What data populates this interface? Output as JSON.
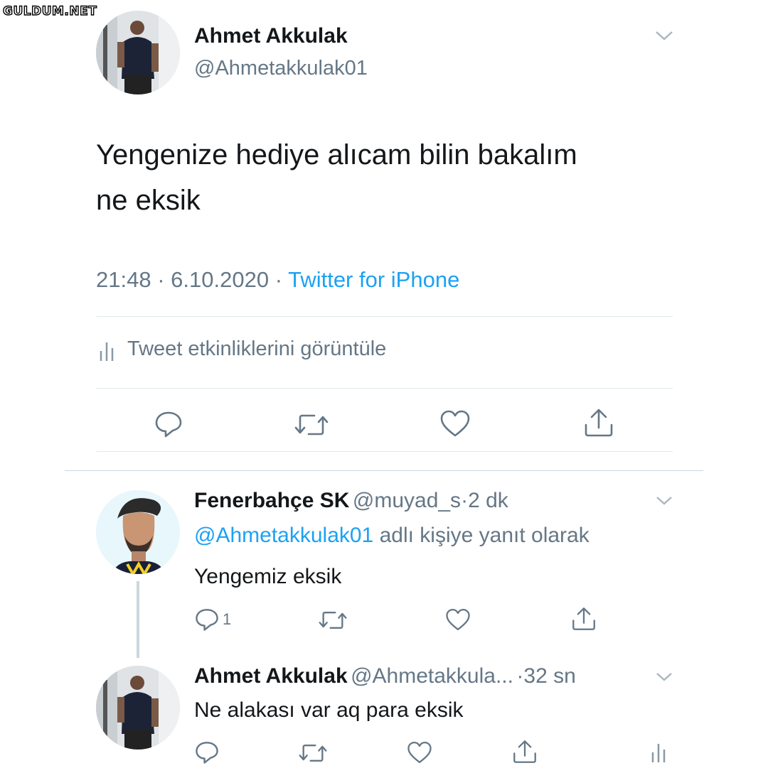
{
  "watermark": "GULDUM.NET",
  "main_tweet": {
    "author_name": "Ahmet Akkulak",
    "author_handle": "@Ahmetakkulak01",
    "text_line1": "Yengenize hediye alıcam bilin bakalım",
    "text_line2": "ne eksik",
    "time": "21:48",
    "date": "6.10.2020",
    "source": "Twitter for iPhone",
    "sep": "·",
    "activity_label": "Tweet etkinliklerini görüntüle"
  },
  "reply1": {
    "author_name": "Fenerbahçe SK",
    "author_handle": "@muyad_s",
    "time": "2 dk",
    "sep": "·",
    "reply_to_mention": "@Ahmetakkulak01",
    "reply_to_suffix": "adlı kişiye yanıt olarak",
    "text": "Yengemiz eksik",
    "reply_count": "1"
  },
  "reply2": {
    "author_name": "Ahmet Akkulak",
    "author_handle": "@Ahmetakkula...",
    "time": "32 sn",
    "sep": "·",
    "text": "Ne alakası var aq para eksik"
  },
  "colors": {
    "link": "#1da1f2",
    "secondary_text": "#657786",
    "divider": "#e1e8ed"
  },
  "icons": [
    "chevron-down-icon",
    "reply-icon",
    "retweet-icon",
    "like-icon",
    "share-icon",
    "analytics-icon"
  ]
}
